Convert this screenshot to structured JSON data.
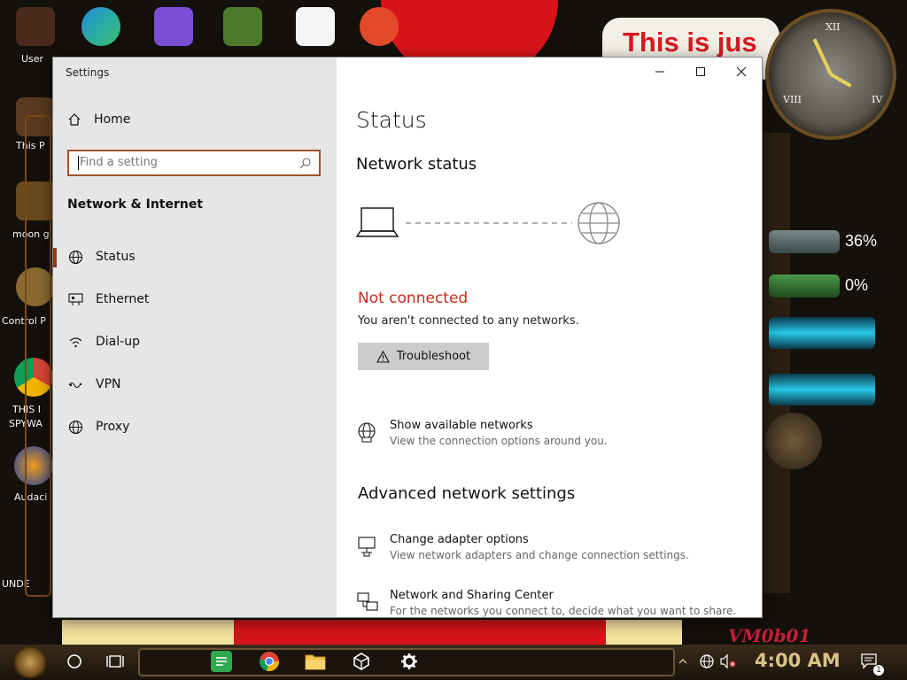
{
  "window": {
    "title": "Settings"
  },
  "sidebar": {
    "home_label": "Home",
    "search_placeholder": "Find a setting",
    "section_title": "Network & Internet",
    "items": [
      {
        "label": "Status",
        "icon": "globe-status-icon",
        "active": true
      },
      {
        "label": "Ethernet",
        "icon": "ethernet-icon",
        "active": false
      },
      {
        "label": "Dial-up",
        "icon": "dialup-icon",
        "active": false
      },
      {
        "label": "VPN",
        "icon": "vpn-icon",
        "active": false
      },
      {
        "label": "Proxy",
        "icon": "globe-icon",
        "active": false
      }
    ]
  },
  "main": {
    "title": "Status",
    "network_status_heading": "Network status",
    "connection_status": "Not connected",
    "connection_desc": "You aren't connected to any networks.",
    "troubleshoot_label": "Troubleshoot",
    "show_networks": {
      "title": "Show available networks",
      "subtitle": "View the connection options around you."
    },
    "advanced_heading": "Advanced network settings",
    "adapter_options": {
      "title": "Change adapter options",
      "subtitle": "View network adapters and change connection settings."
    },
    "sharing_center": {
      "title": "Network and Sharing Center",
      "subtitle": "For the networks you connect to, decide what you want to share."
    }
  },
  "desktop": {
    "banner_text": "This is jus",
    "meters": [
      "36%",
      "0%"
    ],
    "icon_labels": [
      "User",
      "This P",
      "moon gi",
      "Control P",
      "THIS I",
      "SPYWA",
      "Audaci",
      "UNDE"
    ],
    "watermark": "VM0b01"
  },
  "taskbar": {
    "time": "4:00 AM",
    "notification_count": "1"
  },
  "colors": {
    "accent": "#8b3a12",
    "error": "#c42b1c",
    "sidebar_bg": "#e6e6e6"
  }
}
